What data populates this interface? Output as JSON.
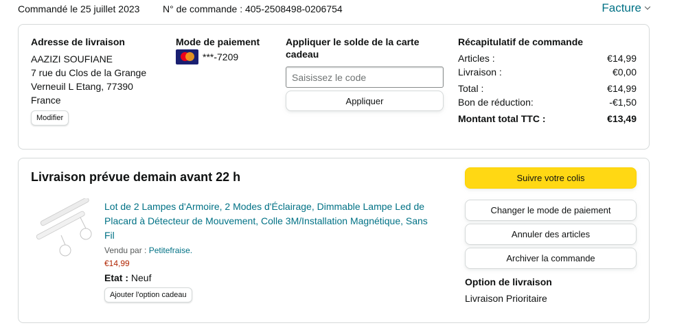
{
  "header": {
    "ordered_on": "Commandé le 25 juillet 2023",
    "order_number": "N° de commande : 405-2508498-0206754",
    "invoice_label": "Facture"
  },
  "shipping_address": {
    "title": "Adresse de livraison",
    "lines": [
      "AAZIZI SOUFIANE",
      "7 rue du Clos de la Grange",
      "Verneuil L Etang, 77390",
      "France"
    ],
    "edit_label": "Modifier"
  },
  "payment": {
    "title": "Mode de paiement",
    "card_icon": "mastercard-icon",
    "card_masked": "***-7209"
  },
  "gift_card": {
    "title": "Appliquer le solde de la carte cadeau",
    "placeholder": "Saisissez le code",
    "value": "",
    "apply_label": "Appliquer"
  },
  "summary": {
    "title": "Récapitulatif de commande",
    "rows": [
      {
        "label": "Articles :",
        "value": "€14,99"
      },
      {
        "label": "Livraison :",
        "value": "€0,00"
      },
      {
        "label": "Total :",
        "value": "€14,99"
      },
      {
        "label": "Bon de réduction:",
        "value": "-€1,50"
      }
    ],
    "grand_total_label": "Montant total TTC :",
    "grand_total_value": "€13,49"
  },
  "shipment": {
    "title": "Livraison prévue demain avant 22 h",
    "product": {
      "title": "Lot de 2 Lampes d'Armoire, 2 Modes d'Éclairage, Dimmable Lampe Led de Placard à Détecteur de Mouvement, Colle 3M/Installation Magnétique, Sans Fil",
      "sold_by_label": "Vendu par :",
      "seller": "Petitefraise.",
      "price": "€14,99",
      "condition_label": "Etat :",
      "condition": "Neuf",
      "gift_option_label": "Ajouter l'option cadeau"
    },
    "actions": {
      "track": "Suivre votre colis",
      "change_payment": "Changer le mode de paiement",
      "cancel_items": "Annuler des articles",
      "archive": "Archiver la commande"
    },
    "delivery_option_title": "Option de livraison",
    "delivery_option": "Livraison Prioritaire"
  },
  "colors": {
    "link": "#007185",
    "price": "#B12704",
    "primary_button": "#FFD814",
    "border": "#D5D9D9"
  }
}
